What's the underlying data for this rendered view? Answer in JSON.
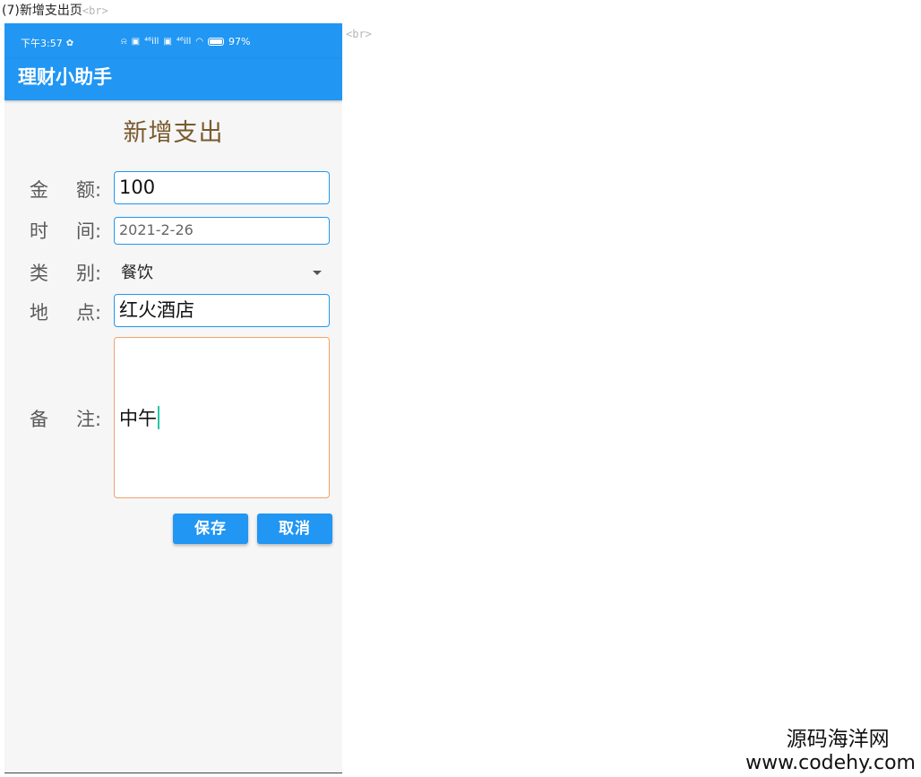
{
  "caption": {
    "text": "(7)新增支出页",
    "br_tag": "<br>"
  },
  "stray_br": "<br>",
  "statusbar": {
    "time": "下午3:57",
    "signal1": "⁴⁶ill",
    "signal2": "⁴⁶ill",
    "battery": "97%"
  },
  "appbar": {
    "title": "理财小助手"
  },
  "form": {
    "title": "新增支出",
    "amount": {
      "label_1": "金",
      "label_2": "额:",
      "value": "100"
    },
    "date": {
      "label_1": "时",
      "label_2": "间:",
      "value": "2021-2-26"
    },
    "category": {
      "label_1": "类",
      "label_2": "别:",
      "value": "餐饮"
    },
    "place": {
      "label_1": "地",
      "label_2": "点:",
      "value": "红火酒店"
    },
    "note": {
      "label_1": "备",
      "label_2": "注:",
      "value": "中午"
    },
    "save_label": "保存",
    "cancel_label": "取消"
  },
  "watermark": {
    "cn": "源码海洋网",
    "en": "www.codehy.com"
  },
  "colors": {
    "primary": "#2196f3",
    "title": "#7a5a2e",
    "note_border": "#f0a36a",
    "cursor": "#26c6a6"
  }
}
